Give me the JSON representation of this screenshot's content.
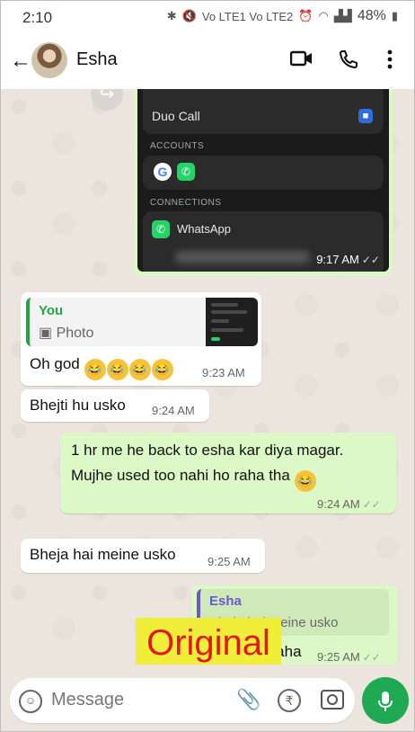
{
  "status_bar": {
    "time": "2:10",
    "battery": "48%",
    "network_labels": "Vo LTE1 Vo LTE2"
  },
  "header": {
    "contact_name": "Esha"
  },
  "forwarded_screenshot": {
    "duo_label": "Duo Call",
    "accounts_header": "ACCOUNTS",
    "connections_header": "CONNECTIONS",
    "whatsapp_label": "WhatsApp",
    "time": "9:17 AM"
  },
  "messages": [
    {
      "id": "m1",
      "quote_name": "You",
      "quote_sub": "Photo",
      "text": "Oh god",
      "time": "9:23 AM"
    },
    {
      "id": "m2",
      "text": "Bhejti hu usko",
      "time": "9:24 AM"
    },
    {
      "id": "m3",
      "line1": "1 hr me he back to esha kar diya magar.",
      "line2": "Mujhe used too nahi ho raha tha",
      "time": "9:24 AM"
    },
    {
      "id": "m4",
      "text": "Bheja hai meine usko",
      "time": "9:25 AM"
    },
    {
      "id": "m5",
      "quote_name": "Esha",
      "quote_text": "Bheja hai meine usko",
      "text": "...aha",
      "time": "9:25 AM"
    }
  ],
  "overlay_label": "Original",
  "input": {
    "placeholder": "Message"
  }
}
